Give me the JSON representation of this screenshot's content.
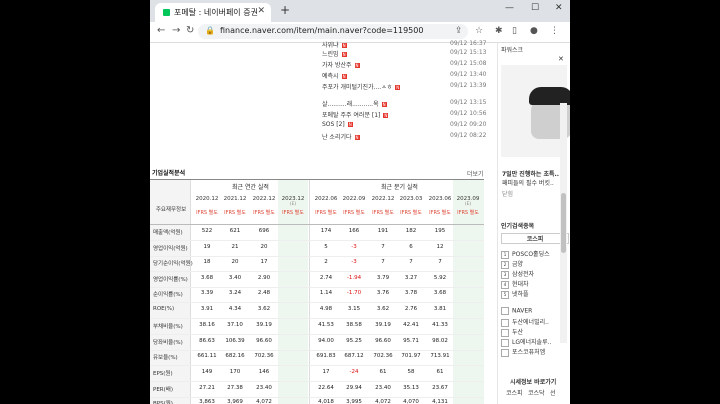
{
  "browser": {
    "tab_title": "포메탈 : 네이버페이 증권",
    "url": "finance.naver.com/item/main.naver?code=119500"
  },
  "news": [
    {
      "title": "사위냐",
      "time": "09/12 16:37"
    },
    {
      "title": "느린밈",
      "time": "09/12 15:13"
    },
    {
      "title": "가자 방산주",
      "time": "09/12 15:08"
    },
    {
      "title": "예측시",
      "time": "09/12 13:40"
    },
    {
      "title": "주포가 개미털기진가....ㅅㅎ",
      "time": "09/12 13:39"
    },
    {
      "title": "살..........래...........옥",
      "time": "09/12 13:15"
    },
    {
      "title": "포메탈 주주 여러분 [1]",
      "time": "09/12 10:56"
    },
    {
      "title": "SOS [2]",
      "time": "09/12 09:20"
    },
    {
      "title": "난 소리기다",
      "time": "09/12 08:22"
    }
  ],
  "financials": {
    "section_title": "기업실적분석",
    "more_label": "더보기",
    "row_header_label": "주요재무정보",
    "annual_label": "최근 연간 실적",
    "quarterly_label": "최근 분기 실적",
    "estimate_label": "(E)",
    "ifrs_label": "IFRS 별도",
    "annual_periods": [
      "2020.12",
      "2021.12",
      "2022.12",
      "2023.12"
    ],
    "quarterly_periods": [
      "2022.06",
      "2022.09",
      "2022.12",
      "2023.03",
      "2023.06",
      "2023.09"
    ],
    "rows": [
      {
        "label": "매출액(억원)",
        "annual": [
          "522",
          "621",
          "696",
          ""
        ],
        "quarterly": [
          "174",
          "166",
          "191",
          "182",
          "195",
          ""
        ]
      },
      {
        "label": "영업이익(억원)",
        "annual": [
          "19",
          "21",
          "20",
          ""
        ],
        "quarterly": [
          "5",
          "-3",
          "7",
          "6",
          "12",
          ""
        ]
      },
      {
        "label": "당기순이익(억원)",
        "annual": [
          "18",
          "20",
          "17",
          ""
        ],
        "quarterly": [
          "2",
          "-3",
          "7",
          "7",
          "7",
          ""
        ]
      },
      {
        "label": "영업이익률(%)",
        "annual": [
          "3.68",
          "3.40",
          "2.90",
          ""
        ],
        "quarterly": [
          "2.74",
          "-1.94",
          "3.79",
          "3.27",
          "5.92",
          ""
        ]
      },
      {
        "label": "순이익률(%)",
        "annual": [
          "3.39",
          "3.24",
          "2.48",
          ""
        ],
        "quarterly": [
          "1.14",
          "-1.70",
          "3.76",
          "3.78",
          "3.68",
          ""
        ]
      },
      {
        "label": "ROE(%)",
        "annual": [
          "3.91",
          "4.34",
          "3.62",
          ""
        ],
        "quarterly": [
          "4.98",
          "3.15",
          "3.62",
          "2.76",
          "3.81",
          ""
        ]
      },
      {
        "label": "부채비율(%)",
        "annual": [
          "38.16",
          "37.10",
          "39.19",
          ""
        ],
        "quarterly": [
          "41.53",
          "38.58",
          "39.19",
          "42.41",
          "41.33",
          ""
        ]
      },
      {
        "label": "당좌비율(%)",
        "annual": [
          "86.63",
          "106.39",
          "96.60",
          ""
        ],
        "quarterly": [
          "94.00",
          "95.25",
          "96.60",
          "95.71",
          "98.02",
          ""
        ]
      },
      {
        "label": "유보율(%)",
        "annual": [
          "661.11",
          "682.16",
          "702.36",
          ""
        ],
        "quarterly": [
          "691.83",
          "687.12",
          "702.36",
          "701.97",
          "713.91",
          ""
        ]
      },
      {
        "label": "EPS(원)",
        "annual": [
          "149",
          "170",
          "146",
          ""
        ],
        "quarterly": [
          "17",
          "-24",
          "61",
          "58",
          "61",
          ""
        ]
      },
      {
        "label": "PER(배)",
        "annual": [
          "27.21",
          "27.38",
          "23.40",
          ""
        ],
        "quarterly": [
          "22.64",
          "29.94",
          "23.40",
          "35.13",
          "23.67",
          ""
        ]
      },
      {
        "label": "BPS(원)",
        "annual": [
          "3,863",
          "3,969",
          "4,072",
          ""
        ],
        "quarterly": [
          "4,018",
          "3,995",
          "4,072",
          "4,070",
          "4,131",
          ""
        ]
      }
    ]
  },
  "sidebar": {
    "top_label": "파워스크",
    "ad_caption_1": "7일만 진행하는 초특..",
    "ad_caption_2": "패피들의 필수 버킷..",
    "ad_link": "닫힘",
    "popular_title": "인기검색종목",
    "kospi_tab": "코스피",
    "popular": [
      "POSCO홀딩스",
      "금양",
      "삼성전자",
      "현대차",
      "넷하플"
    ],
    "recent": [
      "NAVER",
      "두산에너빌리..",
      "두산",
      "LG에너지솔루..",
      "포스코퓨처엠"
    ],
    "market_title": "시세정보 바로가기",
    "market_tabs": [
      "코스피",
      "코스닥",
      "선"
    ]
  }
}
